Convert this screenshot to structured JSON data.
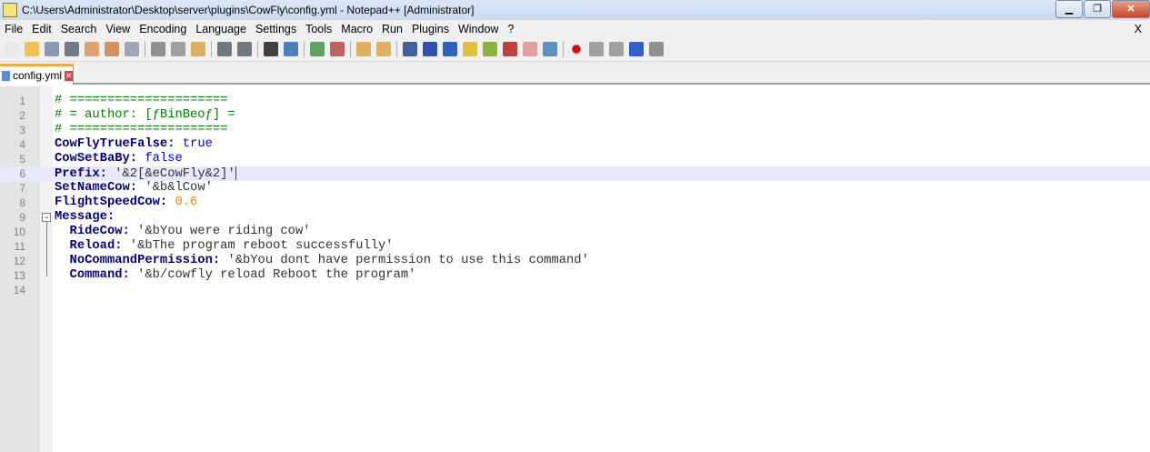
{
  "window": {
    "title": "C:\\Users\\Administrator\\Desktop\\server\\plugins\\CowFly\\config.yml - Notepad++ [Administrator]",
    "minimize": "▁",
    "restore": "❐",
    "close": "✕"
  },
  "menu": [
    "File",
    "Edit",
    "Search",
    "View",
    "Encoding",
    "Language",
    "Settings",
    "Tools",
    "Macro",
    "Run",
    "Plugins",
    "Window",
    "?"
  ],
  "menu_close": "X",
  "tab": {
    "label": "config.yml",
    "close": "✕"
  },
  "editor": {
    "lines": [
      {
        "n": "1",
        "parts": [
          {
            "t": "# =====================",
            "c": "cm"
          }
        ]
      },
      {
        "n": "2",
        "parts": [
          {
            "t": "# = author: [ƒBinBeoƒ] =",
            "c": "cm"
          }
        ]
      },
      {
        "n": "3",
        "parts": [
          {
            "t": "# =====================",
            "c": "cm"
          }
        ]
      },
      {
        "n": "4",
        "parts": [
          {
            "t": "CowFlyTrueFalse:",
            "c": "key"
          },
          {
            "t": " true",
            "c": "bool"
          }
        ]
      },
      {
        "n": "5",
        "parts": [
          {
            "t": "CowSetBaBy:",
            "c": "key"
          },
          {
            "t": " false",
            "c": "bool"
          }
        ]
      },
      {
        "n": "6",
        "parts": [
          {
            "t": "Prefix:",
            "c": "key"
          },
          {
            "t": " '&2[&eCowFly&2]'",
            "c": "str"
          }
        ],
        "current": true
      },
      {
        "n": "7",
        "parts": [
          {
            "t": "SetNameCow:",
            "c": "key"
          },
          {
            "t": " '&b&lCow'",
            "c": "str"
          }
        ]
      },
      {
        "n": "8",
        "parts": [
          {
            "t": "FlightSpeedCow:",
            "c": "key"
          },
          {
            "t": " 0.6",
            "c": "num"
          }
        ]
      },
      {
        "n": "9",
        "parts": [
          {
            "t": "Message:",
            "c": "key"
          }
        ]
      },
      {
        "n": "10",
        "parts": [
          {
            "t": "  RideCow:",
            "c": "key"
          },
          {
            "t": " '&bYou were riding cow'",
            "c": "str"
          }
        ]
      },
      {
        "n": "11",
        "parts": [
          {
            "t": "  Reload:",
            "c": "key"
          },
          {
            "t": " '&bThe program reboot successfully'",
            "c": "str"
          }
        ]
      },
      {
        "n": "12",
        "parts": [
          {
            "t": "  NoCommandPermission:",
            "c": "key"
          },
          {
            "t": " '&bYou dont have permission to use this command'",
            "c": "str"
          }
        ]
      },
      {
        "n": "13",
        "parts": [
          {
            "t": "  Command:",
            "c": "key"
          },
          {
            "t": " '&b/cowfly reload Reboot the program'",
            "c": "str"
          }
        ]
      },
      {
        "n": "14",
        "parts": []
      }
    ]
  },
  "toolbar": [
    "new",
    "open",
    "save",
    "save-all",
    "close",
    "close-all",
    "print",
    "|",
    "cut",
    "copy",
    "paste",
    "|",
    "undo",
    "redo",
    "|",
    "find",
    "replace",
    "|",
    "zoom-in",
    "zoom-out",
    "|",
    "sync-v",
    "sync-h",
    "|",
    "wrap",
    "show-all",
    "indent-guide",
    "udl",
    "doc-map",
    "function-list",
    "folder-workspace",
    "monitor",
    "|",
    "record",
    "stop",
    "play",
    "play-multi",
    "save-macro"
  ],
  "toolbar_colors": {
    "new": "#e8e8e8",
    "open": "#f0c050",
    "save": "#8a9ab0",
    "save-all": "#707a88",
    "close": "#e0a070",
    "close-all": "#d09060",
    "print": "#a0a8b8",
    "cut": "#909090",
    "copy": "#a0a0a0",
    "paste": "#d8b060",
    "undo": "#707880",
    "redo": "#707880",
    "find": "#404040",
    "replace": "#4a80c0",
    "zoom-in": "#60a060",
    "zoom-out": "#c06060",
    "sync-v": "#e0b060",
    "sync-h": "#e0b060",
    "wrap": "#4060a0",
    "show-all": "#3050b0",
    "indent-guide": "#3060c0",
    "udl": "#e0c040",
    "doc-map": "#90b040",
    "function-list": "#c04040",
    "folder-workspace": "#e0a0a0",
    "monitor": "#6090c0",
    "record": "#d01010",
    "stop": "#a0a0a0",
    "play": "#a0a0a0",
    "play-multi": "#3060d0",
    "save-macro": "#909090"
  }
}
